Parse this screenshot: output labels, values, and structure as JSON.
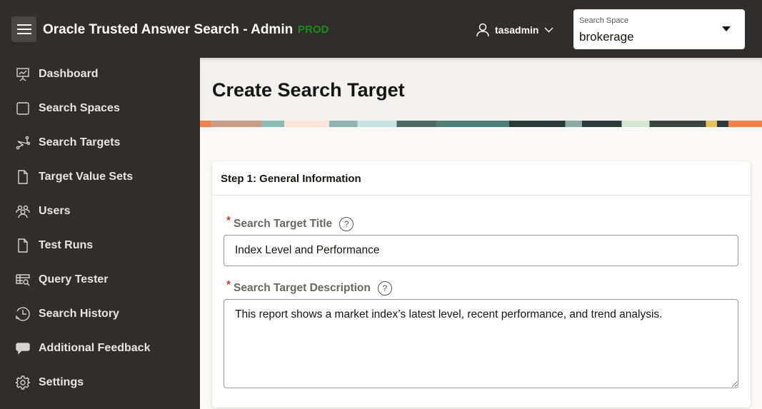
{
  "header": {
    "app_title": "Oracle Trusted Answer Search - Admin",
    "environment": "PROD",
    "username": "tasadmin",
    "search_space": {
      "label": "Search Space",
      "value": "brokerage"
    }
  },
  "sidebar": {
    "items": [
      {
        "label": "Dashboard",
        "icon": "dashboard-icon"
      },
      {
        "label": "Search Spaces",
        "icon": "square-icon"
      },
      {
        "label": "Search Targets",
        "icon": "targets-icon"
      },
      {
        "label": "Target Value Sets",
        "icon": "document-icon"
      },
      {
        "label": "Users",
        "icon": "users-icon"
      },
      {
        "label": "Test Runs",
        "icon": "document-icon"
      },
      {
        "label": "Query Tester",
        "icon": "query-icon"
      },
      {
        "label": "Search History",
        "icon": "history-icon"
      },
      {
        "label": "Additional Feedback",
        "icon": "chat-icon"
      },
      {
        "label": "Settings",
        "icon": "gear-icon"
      }
    ]
  },
  "page": {
    "title": "Create Search Target",
    "step": {
      "title": "Step 1: General Information",
      "fields": {
        "title": {
          "label": "Search Target Title",
          "required": "*",
          "help": "?",
          "value": "Index Level and Performance"
        },
        "description": {
          "label": "Search Target Description",
          "required": "*",
          "help": "?",
          "value": "This report shows a market index’s latest level, recent performance, and trend analysis."
        }
      }
    }
  }
}
